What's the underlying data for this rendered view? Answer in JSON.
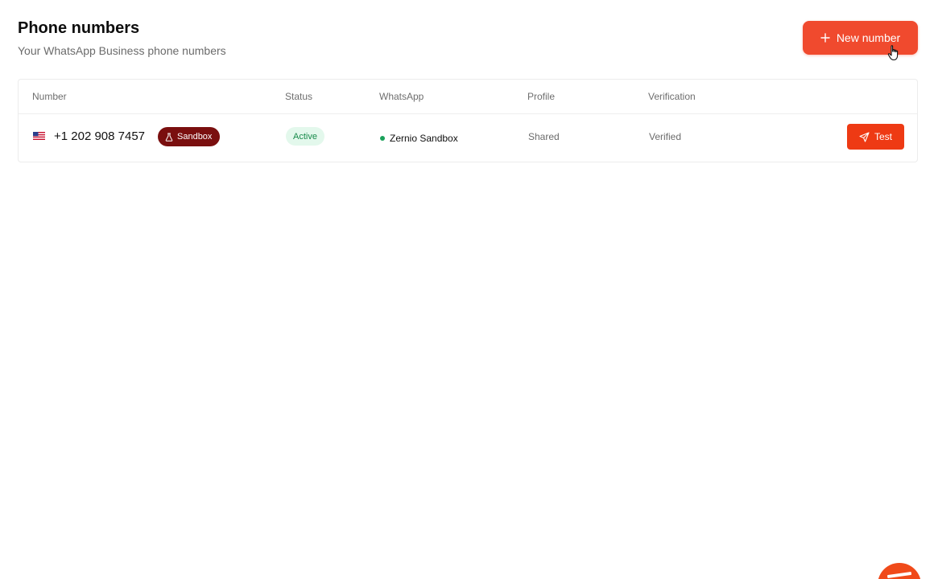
{
  "header": {
    "title": "Phone numbers",
    "subtitle": "Your WhatsApp Business phone numbers"
  },
  "actions": {
    "new_number_label": "New number",
    "new_number_icon": "plus-icon"
  },
  "table": {
    "columns": [
      "Number",
      "Status",
      "WhatsApp",
      "Profile",
      "Verification"
    ],
    "rows": [
      {
        "flag": "us-flag-icon",
        "number": "+1 202 908 7457",
        "badge": "Sandbox",
        "badge_icon": "flask-icon",
        "status": "Active",
        "whatsapp": "Zernio Sandbox",
        "profile": "Shared",
        "verification": "Verified",
        "action_label": "Test",
        "action_icon": "send-icon"
      }
    ]
  },
  "colors": {
    "accent": "#f04a2e",
    "test_button": "#ee3a14",
    "sandbox_badge": "#7a0f0f",
    "status_active_bg": "#e3f8ec",
    "status_active_text": "#178a4a",
    "whatsapp_dot": "#1aa15a"
  }
}
